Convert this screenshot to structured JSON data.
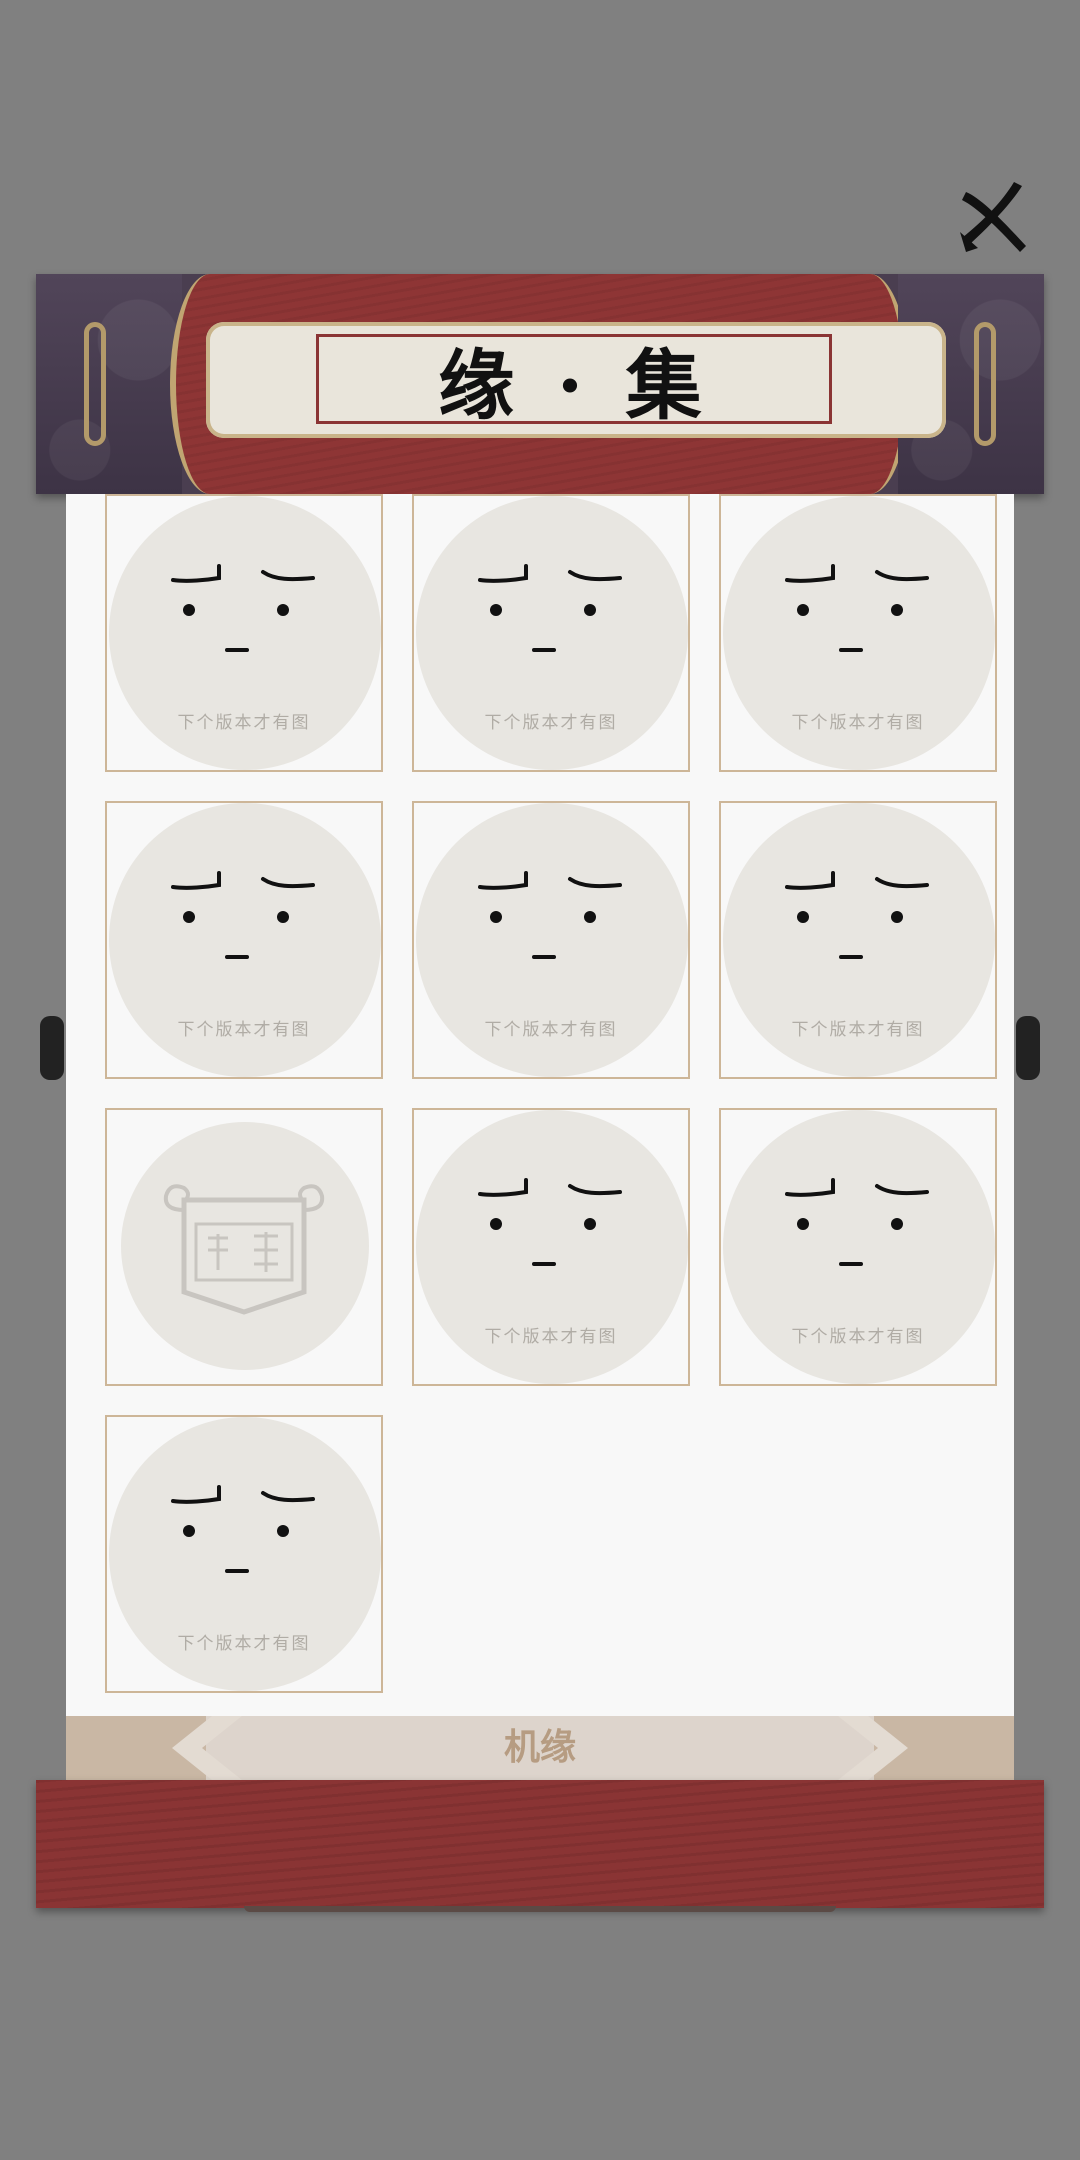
{
  "header": {
    "title": "缘 · 集"
  },
  "close_button": {
    "icon": "brush-x-icon"
  },
  "collection": {
    "tiles": [
      {
        "state": "unlocked",
        "caption": "下个版本才有图"
      },
      {
        "state": "unlocked",
        "caption": "下个版本才有图"
      },
      {
        "state": "unlocked",
        "caption": "下个版本才有图"
      },
      {
        "state": "unlocked",
        "caption": "下个版本才有图"
      },
      {
        "state": "unlocked",
        "caption": "下个版本才有图"
      },
      {
        "state": "unlocked",
        "caption": "下个版本才有图"
      },
      {
        "state": "locked",
        "caption": ""
      },
      {
        "state": "unlocked",
        "caption": "下个版本才有图"
      },
      {
        "state": "unlocked",
        "caption": "下个版本才有图"
      },
      {
        "state": "unlocked",
        "caption": "下个版本才有图"
      }
    ]
  },
  "tab": {
    "label": "机缘"
  },
  "colors": {
    "background": "#808080",
    "paper": "#f8f8f8",
    "wood_red": "#8a3434",
    "header_purple": "#4a3e50",
    "tile_border": "#cdb698",
    "tab_text": "#b69c82"
  }
}
